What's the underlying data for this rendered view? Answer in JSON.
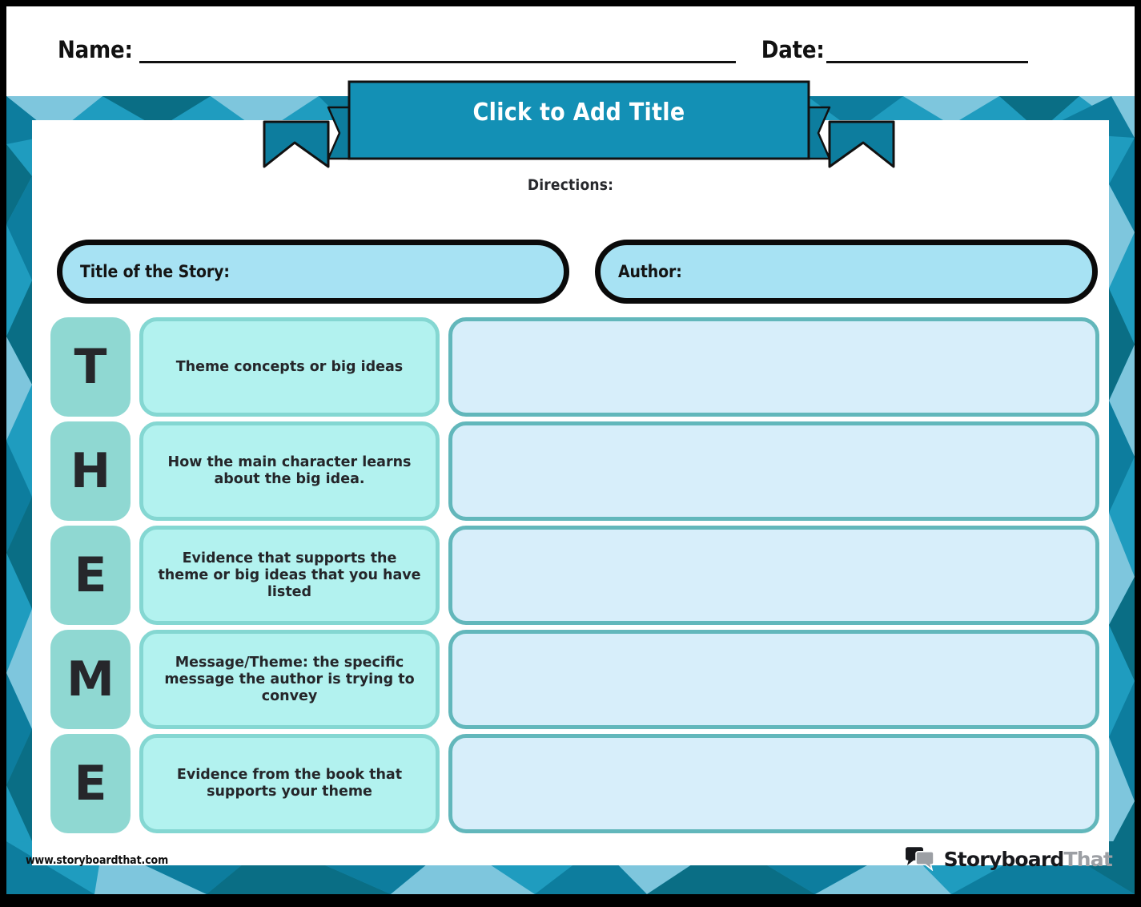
{
  "header": {
    "name_label": "Name:",
    "date_label": "Date:"
  },
  "title_banner": {
    "text": "Click to Add Title"
  },
  "directions": {
    "label": "Directions:"
  },
  "meta": {
    "story_label": "Title of the Story:",
    "author_label": "Author:"
  },
  "rows": [
    {
      "letter": "T",
      "prompt": "Theme concepts or big ideas",
      "answer": ""
    },
    {
      "letter": "H",
      "prompt": "How the main character learns about the big idea.",
      "answer": ""
    },
    {
      "letter": "E",
      "prompt": "Evidence that supports the theme or big ideas that you have listed",
      "answer": ""
    },
    {
      "letter": "M",
      "prompt": "Message/Theme: the specific message the author is trying to convey",
      "answer": ""
    },
    {
      "letter": "E",
      "prompt": "Evidence from the book that supports your theme",
      "answer": ""
    }
  ],
  "footer": {
    "url": "www.storyboardthat.com",
    "logo_word_1": "Storyboard",
    "logo_word_2": "That"
  },
  "colors": {
    "banner": "#1390b5",
    "banner_tail": "#0d7d9e",
    "letter_tile": "#8fd8d2",
    "prompt_fill": "#b2f2ef",
    "prompt_border": "#84d7d2",
    "answer_fill": "#d7eefa",
    "answer_border": "#62b7bb",
    "meta_fill": "#a7e2f3",
    "meta_border": "#0a0a0a",
    "poly_dark": "#0d7d9e",
    "poly_mid": "#1f9cbf",
    "poly_light": "#7ec6dd",
    "poly_deep": "#0a6e85",
    "page_bg": "#ffffff",
    "outer_bg": "#000000"
  }
}
